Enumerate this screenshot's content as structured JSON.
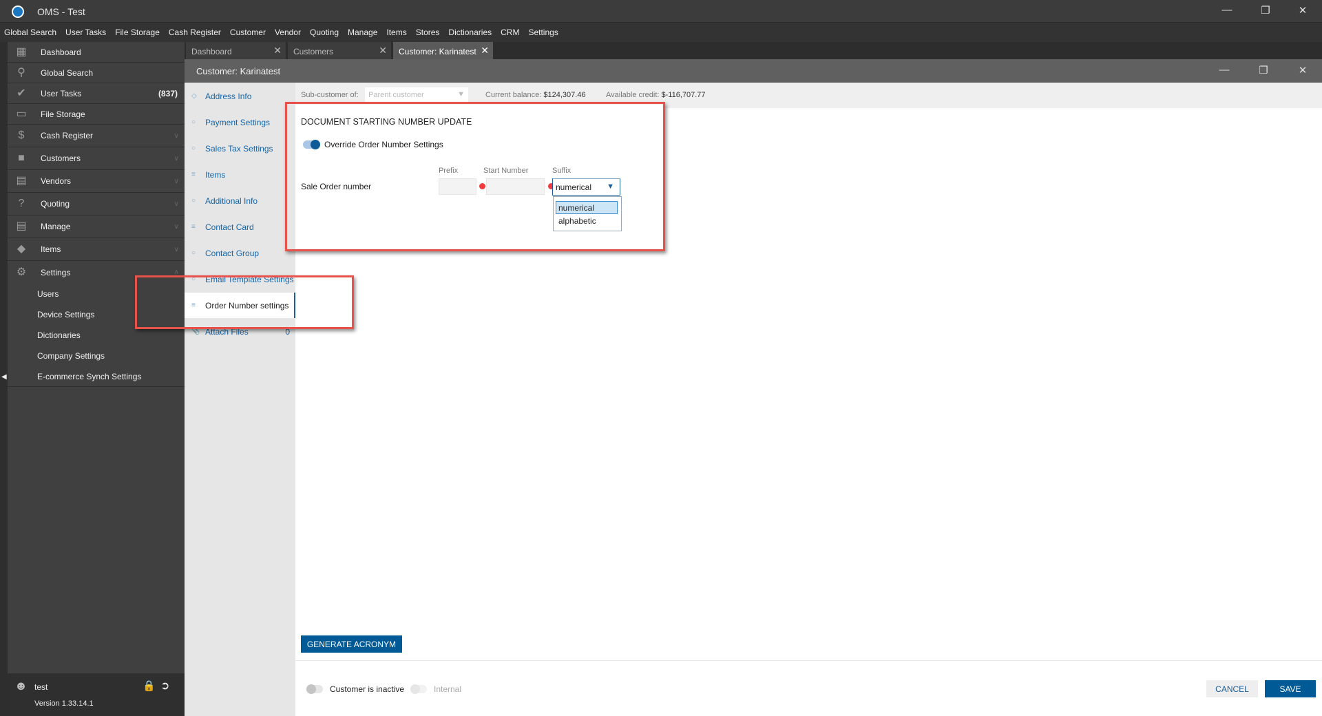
{
  "app": {
    "title": "OMS - Test"
  },
  "menu": [
    "Global Search",
    "User Tasks",
    "File Storage",
    "Cash Register",
    "Customer",
    "Vendor",
    "Quoting",
    "Manage",
    "Items",
    "Stores",
    "Dictionaries",
    "CRM",
    "Settings"
  ],
  "sidebar": {
    "items": [
      {
        "label": "Dashboard",
        "icon": "dashboard-icon"
      },
      {
        "label": "Global Search",
        "icon": "search-icon"
      },
      {
        "label": "User Tasks",
        "icon": "check-icon",
        "count": "(837)"
      },
      {
        "label": "File Storage",
        "icon": "folder-icon"
      },
      {
        "label": "Cash Register",
        "icon": "dollar-icon"
      },
      {
        "label": "Customers",
        "icon": "contact-icon"
      },
      {
        "label": "Vendors",
        "icon": "store-icon"
      },
      {
        "label": "Quoting",
        "icon": "quote-icon"
      },
      {
        "label": "Manage",
        "icon": "clipboard-icon"
      },
      {
        "label": "Items",
        "icon": "tag-icon"
      },
      {
        "label": "Settings",
        "icon": "gear-icon"
      }
    ],
    "settings_sub": [
      "Users",
      "Device Settings",
      "Dictionaries",
      "Company Settings",
      "E-commerce Synch Settings"
    ],
    "user": "test",
    "version": "Version 1.33.14.1"
  },
  "tabs": [
    {
      "label": "Dashboard"
    },
    {
      "label": "Customers"
    },
    {
      "label": "Customer: Karinatest",
      "active": true
    }
  ],
  "window": {
    "title": "Customer: Karinatest"
  },
  "left_nav": [
    {
      "label": "Address Info"
    },
    {
      "label": "Payment Settings"
    },
    {
      "label": "Sales Tax Settings"
    },
    {
      "label": "Items"
    },
    {
      "label": "Additional Info"
    },
    {
      "label": "Contact Card"
    },
    {
      "label": "Contact Group"
    },
    {
      "label": "Email Template Settings"
    },
    {
      "label": "Order Number settings",
      "active": true
    },
    {
      "label": "Attach Files",
      "count": "0"
    }
  ],
  "customer_bar": {
    "sub_customer_label": "Sub-customer of:",
    "sub_customer_placeholder": "Parent customer",
    "balance_label": "Current balance:",
    "balance": "$124,307.46",
    "credit_label": "Available credit:",
    "credit": "$-116,707.77"
  },
  "form": {
    "heading": "DOCUMENT STARTING NUMBER UPDATE",
    "override_label": "Override Order Number Settings",
    "override_on": true,
    "prefix_label": "Prefix",
    "start_label": "Start Number",
    "suffix_label": "Suffix",
    "row_label": "Sale Order number",
    "prefix_value": "",
    "start_value": "",
    "suffix_value": "numerical",
    "suffix_options": [
      "numerical",
      "alphabetic"
    ]
  },
  "buttons": {
    "generate": "GENERATE ACRONYM",
    "cancel": "CANCEL",
    "save": "SAVE"
  },
  "footer": {
    "inactive_label": "Customer is inactive",
    "internal_label": "Internal"
  },
  "colors": {
    "accent": "#005a96",
    "highlight": "#e8524a"
  }
}
